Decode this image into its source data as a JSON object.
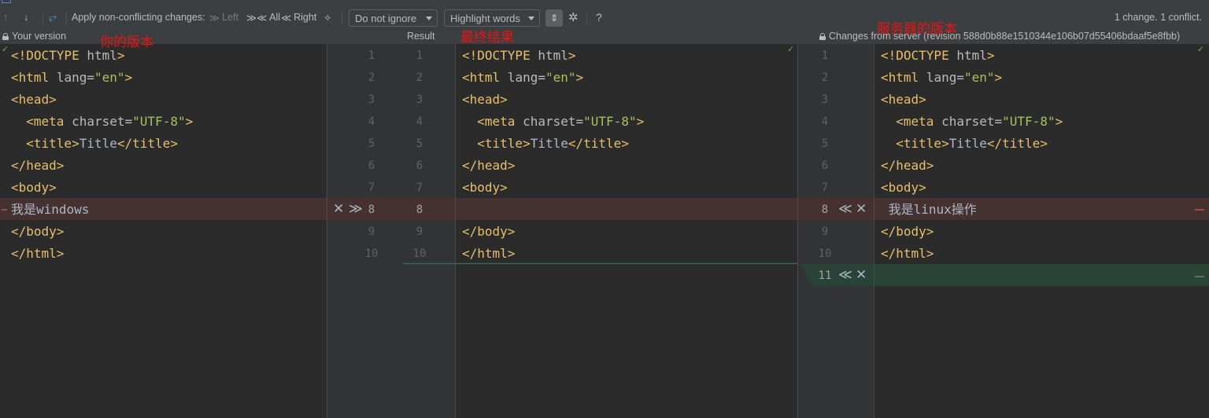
{
  "toolbar": {
    "prev_icon": "↑",
    "next_icon": "↓",
    "magic_icon": "⥂",
    "apply_label": "Apply non-conflicting changes:",
    "left_label": "Left",
    "all_label": "All",
    "right_label": "Right",
    "wand_icon": "✧",
    "ignore_value": "Do not ignore",
    "highlight_value": "Highlight words",
    "toggle_icon": "⇕",
    "gear_icon": "✲",
    "help_icon": "?",
    "status": "1 change. 1 conflict."
  },
  "headers": {
    "left": "Your version",
    "result": "Result",
    "right": "Changes from server (revision 588d0b88e1510344e106b07d55406bdaaf5e8fbb)"
  },
  "annotations": {
    "left": "你的版本",
    "result": "最终结果",
    "right": "服务器的版本"
  },
  "left_lines": [
    "<!DOCTYPE html>",
    "<html lang=\"en\">",
    "<head>",
    "  <meta charset=\"UTF-8\">",
    "  <title>Title</title>",
    "</head>",
    "<body>",
    "我是windows",
    "</body>",
    "</html>"
  ],
  "result_lines": [
    "<!DOCTYPE html>",
    "<html lang=\"en\">",
    "<head>",
    "  <meta charset=\"UTF-8\">",
    "  <title>Title</title>",
    "</head>",
    "<body>",
    "",
    "</body>",
    "</html>"
  ],
  "right_lines": [
    "<!DOCTYPE html>",
    "<html lang=\"en\">",
    "<head>",
    "  <meta charset=\"UTF-8\">",
    "  <title>Title</title>",
    "</head>",
    "<body>",
    " 我是linux操作",
    "</body>",
    "</html>",
    ""
  ],
  "line_numbers": {
    "left_gutter": [
      "1",
      "2",
      "3",
      "4",
      "5",
      "6",
      "7",
      "8",
      "9",
      "10"
    ],
    "result_gutter": [
      "1",
      "2",
      "3",
      "4",
      "5",
      "6",
      "7",
      "8",
      "9",
      "10"
    ],
    "right_gutter": [
      "1",
      "2",
      "3",
      "4",
      "5",
      "6",
      "7",
      "8",
      "9",
      "10",
      "11"
    ]
  },
  "actions": {
    "ignore_icon": "✕",
    "accept_left_icon": "≫",
    "accept_right_icon": "≪"
  },
  "colors": {
    "conflict_bg": "#45312f",
    "insert_bg": "#294436",
    "tag": "#e8bf6a",
    "string": "#a5c25c",
    "annotation": "#e81414"
  }
}
